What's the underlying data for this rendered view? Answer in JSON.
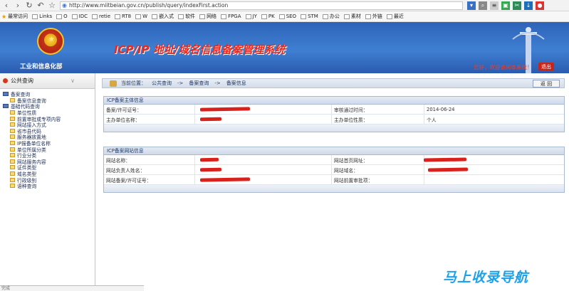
{
  "browser": {
    "url": "http://www.miitbeian.gov.cn/publish/query/indexFirst.action",
    "bookmarks": [
      "最常访问",
      "Links",
      "O",
      "IDC",
      "retie",
      "RT8",
      "W",
      "嵌入式",
      "软件",
      "网络",
      "FPGA",
      "JY",
      "PK",
      "SEO",
      "STM",
      "办公",
      "素材",
      "外链",
      "最近"
    ]
  },
  "header": {
    "ministry": "工业和信息化部",
    "title": "ICP/IP 地址/域名信息备案管理系统",
    "welcome": "您好，欢迎访问本系统！",
    "logout_label": "退出"
  },
  "sidebar": {
    "title": "公共查询",
    "groups": [
      {
        "label": "备案查询",
        "items": [
          "备案信息查询"
        ]
      },
      {
        "label": "基础代码查询",
        "items": [
          "单位性质",
          "前置审批或专项内容",
          "网站接入方式",
          "省市县代码",
          "服务器放置地",
          "IP报备单位名称",
          "单位所属分类",
          "行业分类",
          "网站服务内容",
          "证件类型",
          "域名类型",
          "行政级别",
          "语种查询"
        ]
      }
    ]
  },
  "breadcrumb": {
    "prefix": "当前位置：",
    "items": [
      "公共查询",
      "->",
      "备案查询",
      "->",
      "备案信息"
    ],
    "back_label": "返 回"
  },
  "icp_subject": {
    "title": "ICP备案主体信息",
    "rows": [
      {
        "l1": "备案/许可证号：",
        "v1": "",
        "l2": "审核通过时间：",
        "v2": "2014-06-24"
      },
      {
        "l1": "主办单位名称：",
        "v1": "",
        "l2": "主办单位性质：",
        "v2": "个人"
      }
    ]
  },
  "icp_site": {
    "title": "ICP备案网站信息",
    "rows": [
      {
        "l1": "网站名称：",
        "v1": "",
        "l2": "网站首页网址：",
        "v2": ""
      },
      {
        "l1": "网站负责人姓名：",
        "v1": "",
        "l2": "网站域名：",
        "v2": ""
      },
      {
        "l1": "网站备案/许可证号：",
        "v1": "",
        "l2": "网站前置审批项：",
        "v2": ""
      }
    ]
  },
  "statusbar": {
    "text": "完成"
  },
  "watermark": "马上收录导航",
  "colors": {
    "header_blue": "#3f7fd2",
    "title_red": "#e52a1f",
    "redact_red": "#d8201c"
  }
}
